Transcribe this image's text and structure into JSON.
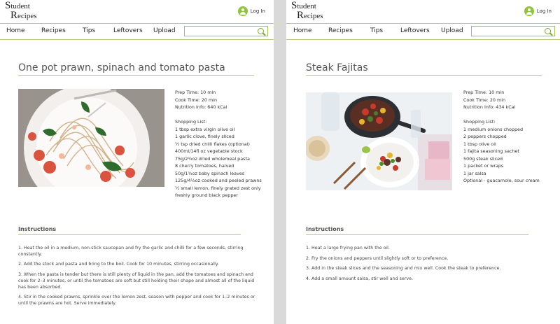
{
  "site": {
    "logo_line1_initial": "S",
    "logo_line1_rest": "tudent",
    "logo_line2_initial": "R",
    "logo_line2_rest": "ecipes",
    "login_label": "Log In",
    "nav": [
      "Home",
      "Recipes",
      "Tips",
      "Leftovers",
      "Upload"
    ],
    "search_value": ""
  },
  "left": {
    "title": "One pot prawn, spinach and tomato pasta",
    "info": [
      "Prep Time: 10 min",
      "Cook Time: 20 min",
      "Nutrition Info: 640 kCal"
    ],
    "shopping_label": "Shopping List:",
    "shopping": [
      "1 tbsp extra virgin olive oil",
      "1 garlic clove, finely sliced",
      "½ tsp dried chilli flakes (optional)",
      "400ml/14fl oz vegetable stock",
      "75g/2¾oz dried wholemeal pasta",
      "8 cherry tomatoes, halved",
      "50g/1¾oz baby spinach leaves",
      "125g/4½oz cooked and peeled prawns",
      "½ small lemon, finely grated zest only",
      "freshly ground black pepper"
    ],
    "instructions_label": "Instructions",
    "steps": [
      "1. Heat the oil in a medium, non-stick saucepan and fry the garlic and chilli for a few seconds, stirring constantly.",
      "2. Add the stock and pasta and bring to the boil. Cook for 10 minutes, stirring occasionally.",
      "3. When the pasta is tender but there is still plenty of liquid in the pan, add the tomatoes and spinach and cook for 2–3 minutes, or until the tomatoes are soft but still holding their shape and almost all of the liquid has been absorbed.",
      "4. Stir in the cooked prawns, sprinkle over the lemon zest, season with pepper and cook for 1–2 minutes or until the prawns are hot. Serve immediately."
    ]
  },
  "right": {
    "title": "Steak Fajitas",
    "info": [
      "Prep Time: 10 min",
      "Cook Time: 20 min",
      "Nutrition Info: 434 kCal"
    ],
    "shopping_label": "Shopping List:",
    "shopping": [
      "1 medium onions chopped",
      "2 peppers chopped",
      "1 tbsp olive oil",
      "1 fajita seasoning sachet",
      "500g steak sliced",
      "1 packet or wraps",
      "1 jar salsa",
      "Optional - guacamole, sour cream"
    ],
    "instructions_label": "Instructions",
    "steps": [
      "1. Heat a large frying pan with the oil.",
      "2. Fry the onions and peppers until slightly soft or to preference.",
      "3. Add in the steak slices and the seasoning and mix well. Cook the steak to preference.",
      "4. Add a small amount salsa, stir well and serve."
    ]
  },
  "colors": {
    "accent": "#9fc54a",
    "rule": "#b5cf73",
    "avatar": "#8fc43c"
  }
}
